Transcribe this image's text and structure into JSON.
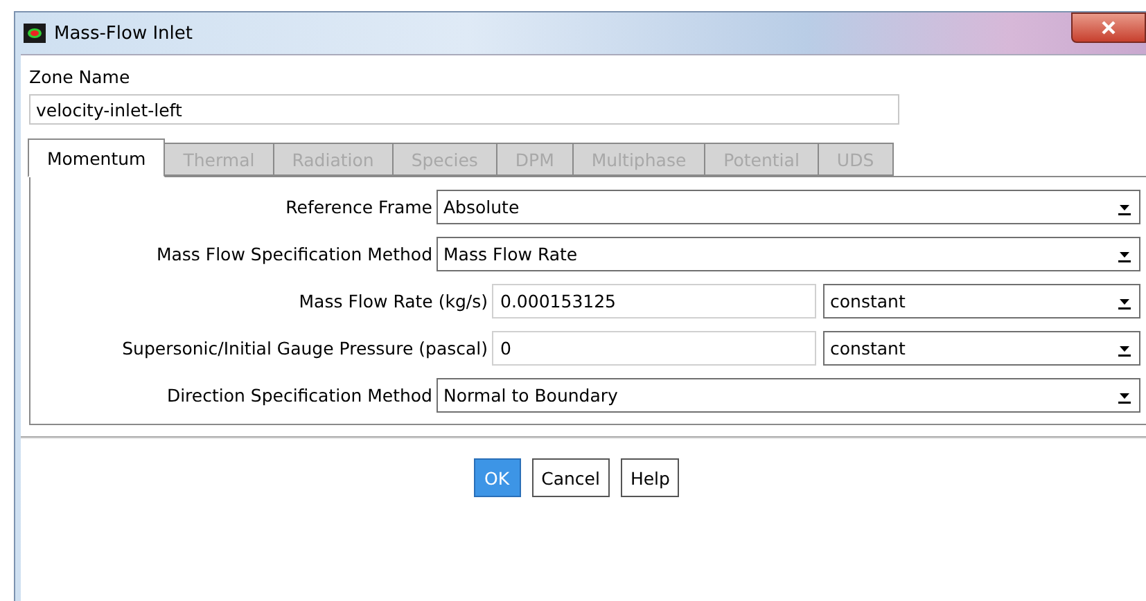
{
  "window": {
    "title": "Mass-Flow Inlet"
  },
  "zone_name": {
    "label": "Zone Name",
    "value": "velocity-inlet-left"
  },
  "tabs": [
    {
      "label": "Momentum",
      "selected": true,
      "disabled": false
    },
    {
      "label": "Thermal",
      "selected": false,
      "disabled": true
    },
    {
      "label": "Radiation",
      "selected": false,
      "disabled": true
    },
    {
      "label": "Species",
      "selected": false,
      "disabled": true
    },
    {
      "label": "DPM",
      "selected": false,
      "disabled": true
    },
    {
      "label": "Multiphase",
      "selected": false,
      "disabled": true
    },
    {
      "label": "Potential",
      "selected": false,
      "disabled": true
    },
    {
      "label": "UDS",
      "selected": false,
      "disabled": true
    }
  ],
  "fields": [
    {
      "kind": "dropdown",
      "label": "Reference Frame",
      "value": "Absolute"
    },
    {
      "kind": "dropdown",
      "label": "Mass Flow Specification Method",
      "value": "Mass Flow Rate"
    },
    {
      "kind": "input",
      "label": "Mass Flow Rate (kg/s)",
      "value": "0.000153125",
      "option": "constant"
    },
    {
      "kind": "input",
      "label": "Supersonic/Initial Gauge Pressure (pascal)",
      "value": "0",
      "option": "constant"
    },
    {
      "kind": "dropdown",
      "label": "Direction Specification Method",
      "value": "Normal to Boundary"
    }
  ],
  "buttons": [
    {
      "label": "OK",
      "default": true
    },
    {
      "label": "Cancel",
      "default": false
    },
    {
      "label": "Help",
      "default": false
    }
  ]
}
